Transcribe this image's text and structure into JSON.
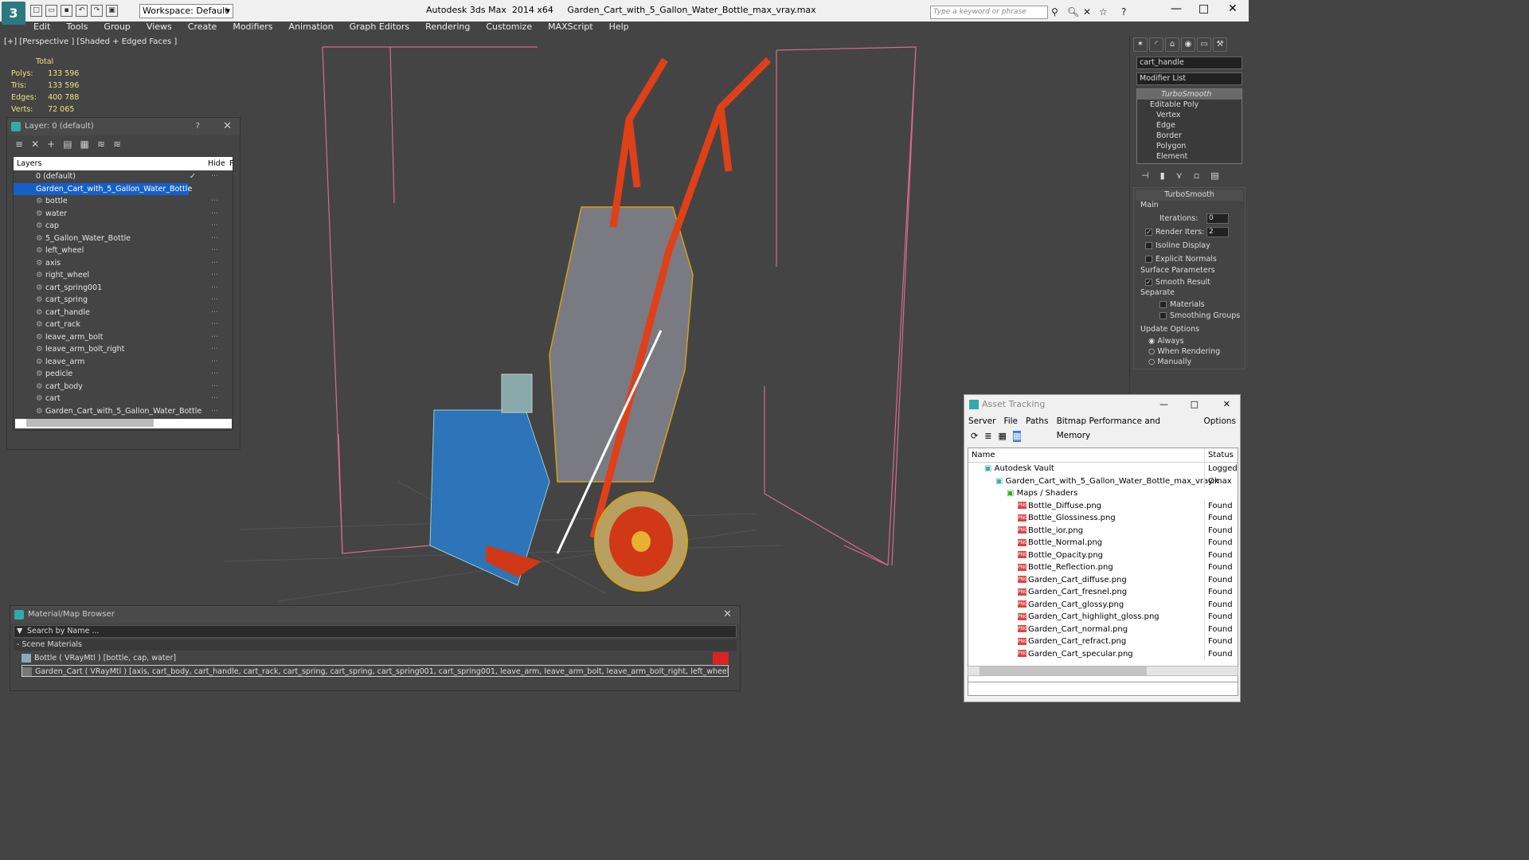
{
  "titlebar": {
    "workspace": "Workspace: Default",
    "app": "Autodesk 3ds Max  2014 x64",
    "file": "Garden_Cart_with_5_Gallon_Water_Bottle_max_vray.max",
    "search_placeholder": "Type a keyword or phrase"
  },
  "menu": [
    "Edit",
    "Tools",
    "Group",
    "Views",
    "Create",
    "Modifiers",
    "Animation",
    "Graph Editors",
    "Rendering",
    "Customize",
    "MAXScript",
    "Help"
  ],
  "viewport": {
    "label": "[+] [Perspective ] [Shaded + Edged Faces ]",
    "stats_header": "Total",
    "stats": [
      {
        "k": "Polys:",
        "v": "133 596"
      },
      {
        "k": "Tris:",
        "v": "133 596"
      },
      {
        "k": "Edges:",
        "v": "400 788"
      },
      {
        "k": "Verts:",
        "v": "72 065"
      }
    ]
  },
  "layers": {
    "title": "Layer: 0 (default)",
    "help": "?",
    "col_layers": "Layers",
    "col_hide": "Hide",
    "col_f": "F",
    "default": "0 (default)",
    "group": "Garden_Cart_with_5_Gallon_Water_Bottle",
    "items": [
      "bottle",
      "water",
      "cap",
      "5_Gallon_Water_Bottle",
      "left_wheel",
      "axis",
      "right_wheel",
      "cart_spring001",
      "cart_spring",
      "cart_handle",
      "cart_rack",
      "leave_arm_bolt",
      "leave_arm_bolt_right",
      "leave_arm",
      "pedicle",
      "cart_body",
      "cart",
      "Garden_Cart_with_5_Gallon_Water_Bottle"
    ]
  },
  "command": {
    "object": "cart_handle",
    "modifier_list": "Modifier List",
    "stack": [
      "TurboSmooth",
      "Editable Poly",
      "Vertex",
      "Edge",
      "Border",
      "Polygon",
      "Element"
    ],
    "rollout": "TurboSmooth",
    "main": "Main",
    "iterations_label": "Iterations:",
    "iterations": "0",
    "render_iters_label": "Render Iters:",
    "render_iters": "2",
    "isoline": "Isoline Display",
    "explicit": "Explicit Normals",
    "surface": "Surface Parameters",
    "smooth": "Smooth Result",
    "separate": "Separate",
    "materials": "Materials",
    "smoothing": "Smoothing Groups",
    "update": "Update Options",
    "always": "Always",
    "when_rendering": "When Rendering",
    "manually": "Manually"
  },
  "asset": {
    "title": "Asset Tracking",
    "menu": [
      "Server",
      "File",
      "Paths",
      "Bitmap Performance and Memory",
      "Options"
    ],
    "col_name": "Name",
    "col_status": "Status",
    "rows": [
      {
        "name": "Autodesk Vault",
        "status": "Logged O",
        "indent": 1
      },
      {
        "name": "Garden_Cart_with_5_Gallon_Water_Bottle_max_vray.max",
        "status": "Ok",
        "indent": 2
      },
      {
        "name": "Maps / Shaders",
        "status": "",
        "indent": 3
      },
      {
        "name": "Bottle_Diffuse.png",
        "status": "Found",
        "indent": 4
      },
      {
        "name": "Bottle_Glossiness.png",
        "status": "Found",
        "indent": 4
      },
      {
        "name": "Bottle_ior.png",
        "status": "Found",
        "indent": 4
      },
      {
        "name": "Bottle_Normal.png",
        "status": "Found",
        "indent": 4
      },
      {
        "name": "Bottle_Opacity.png",
        "status": "Found",
        "indent": 4
      },
      {
        "name": "Bottle_Reflection.png",
        "status": "Found",
        "indent": 4
      },
      {
        "name": "Garden_Cart_diffuse.png",
        "status": "Found",
        "indent": 4
      },
      {
        "name": "Garden_Cart_fresnel.png",
        "status": "Found",
        "indent": 4
      },
      {
        "name": "Garden_Cart_glossy.png",
        "status": "Found",
        "indent": 4
      },
      {
        "name": "Garden_Cart_highlight_gloss.png",
        "status": "Found",
        "indent": 4
      },
      {
        "name": "Garden_Cart_normal.png",
        "status": "Found",
        "indent": 4
      },
      {
        "name": "Garden_Cart_refract.png",
        "status": "Found",
        "indent": 4
      },
      {
        "name": "Garden_Cart_specular.png",
        "status": "Found",
        "indent": 4
      }
    ]
  },
  "material": {
    "title": "Material/Map Browser",
    "search": "Search by Name ...",
    "section": "Scene Materials",
    "items": [
      "Bottle  ( VRayMtl ) [bottle, cap, water]",
      "Garden_Cart  ( VRayMtl ) [axis, cart_body, cart_handle, cart_rack, cart_spring, cart_spring, cart_spring001, cart_spring001, leave_arm, leave_arm_bolt, leave_arm_bolt_right, left_wheel, pedicle, right_wheel]"
    ]
  }
}
